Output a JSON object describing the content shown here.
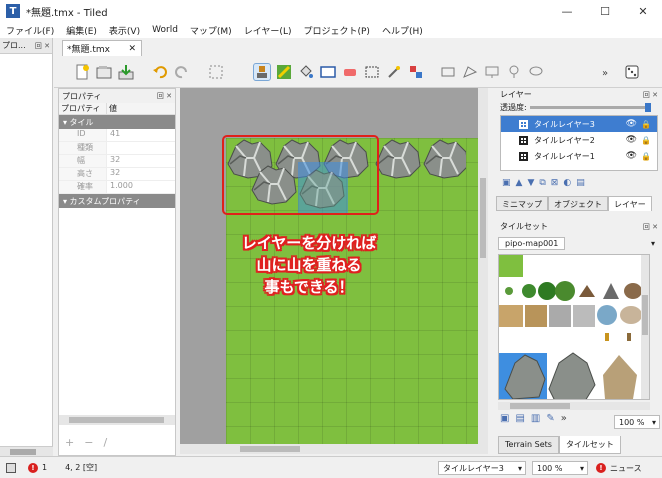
{
  "window": {
    "title": "*無題.tmx - Tiled",
    "app_icon": "T",
    "minimize": "—",
    "maximize": "☐",
    "close": "✕"
  },
  "menu": [
    "ファイル(F)",
    "編集(E)",
    "表示(V)",
    "World",
    "マップ(M)",
    "レイヤー(L)",
    "プロジェクト(P)",
    "ヘルプ(H)"
  ],
  "left_panel": {
    "title": "プロ...",
    "controls": "回 ✕"
  },
  "document_tab": {
    "label": "*無題.tmx",
    "close": "✕"
  },
  "properties": {
    "title": "プロパティ",
    "controls": "回 ✕",
    "col_name": "プロパティ",
    "col_value": "値",
    "group_tile": "▾ タイル",
    "rows": [
      {
        "name": "ID",
        "value": "41"
      },
      {
        "name": "種類",
        "value": ""
      },
      {
        "name": "幅",
        "value": "32"
      },
      {
        "name": "高さ",
        "value": "32"
      },
      {
        "name": "確率",
        "value": "1.000"
      }
    ],
    "group_custom": "▾ カスタムプロパティ",
    "buttons": [
      "+",
      "−",
      "/"
    ]
  },
  "annotation": {
    "lines": [
      "レイヤーを分ければ",
      "山に山を重ねる",
      "事もできる！"
    ]
  },
  "layers_panel": {
    "title": "レイヤー",
    "controls": "回 ✕",
    "opacity_label": "透過度:",
    "opacity": 1.0,
    "items": [
      {
        "name": "タイルレイヤー3",
        "selected": true
      },
      {
        "name": "タイルレイヤー2",
        "selected": false
      },
      {
        "name": "タイルレイヤー1",
        "selected": false
      }
    ],
    "eye": "👁",
    "lock": "🔒",
    "tabs": [
      "ミニマップ",
      "オブジェクト",
      "レイヤー"
    ],
    "active_tab": "レイヤー"
  },
  "tilesets_panel": {
    "title": "タイルセット",
    "controls": "回 ✕",
    "tileset_tab": "pipo-map001",
    "zoom": "100 %",
    "bottom_tabs": [
      "Terrain Sets",
      "タイルセット"
    ],
    "active_bottom_tab": "タイルセット"
  },
  "status": {
    "error_count": "1",
    "warn_label": "!",
    "coords": "4, 2 [空]",
    "layer_combo": "タイルレイヤー3",
    "zoom_combo": "100 %",
    "news": "ニュース"
  },
  "colors": {
    "grass": "#7fbf3f",
    "selection": "#3e7dd0",
    "highlight_rect": "#e0201a",
    "annotation_outline": "#e02020"
  }
}
